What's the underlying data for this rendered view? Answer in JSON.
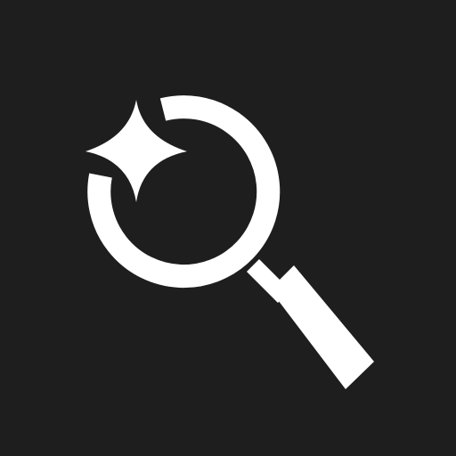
{
  "icon": {
    "name": "magnifier-sparkle-icon",
    "background_color": "#1e1e1e",
    "foreground_color": "#ffffff"
  }
}
